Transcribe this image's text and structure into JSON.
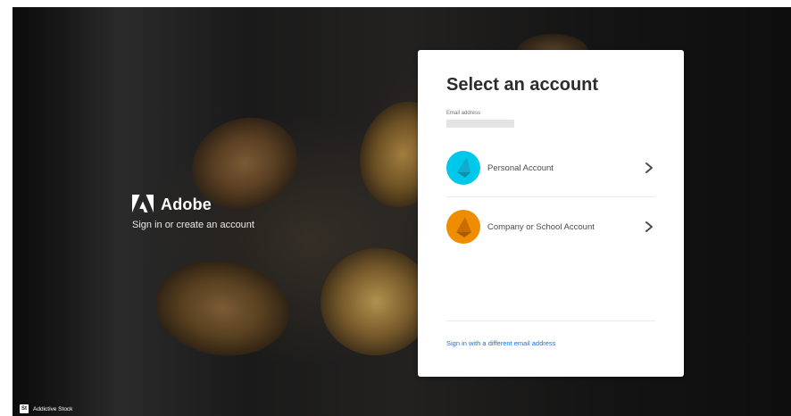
{
  "brand": {
    "name": "Adobe",
    "subtitle": "Sign in or create an account"
  },
  "photo_credit": {
    "badge": "St",
    "text": "Addictive Stock"
  },
  "card": {
    "title": "Select an account",
    "email_label": "Email address",
    "email_value": "",
    "accounts": [
      {
        "label": "Personal Account",
        "color": "#00c8ea",
        "icon": "personal-avatar-icon"
      },
      {
        "label": "Company or School Account",
        "color": "#f08c00",
        "icon": "company-avatar-icon"
      }
    ],
    "different_email_link": "Sign in with a different email address"
  },
  "colors": {
    "link": "#1473e6",
    "title": "#2c2c2c"
  }
}
